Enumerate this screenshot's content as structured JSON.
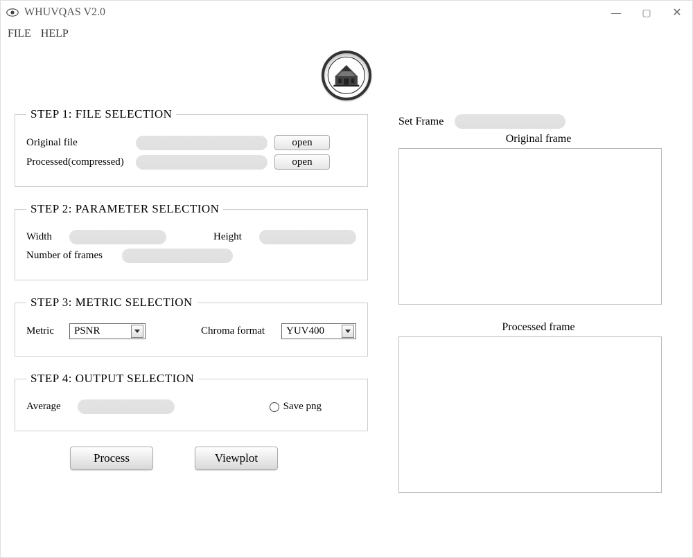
{
  "window": {
    "title": "WHUVQAS V2.0",
    "menu": {
      "file": "FILE",
      "help": "HELP"
    },
    "controls": {
      "min": "—",
      "max": "▢",
      "close": "✕"
    }
  },
  "logo": {
    "name": "university-seal"
  },
  "step1": {
    "legend": "STEP 1: FILE SELECTION",
    "original_label": "Original file",
    "processed_label": "Processed(compressed)",
    "open_label": "open"
  },
  "step2": {
    "legend": "STEP 2: PARAMETER SELECTION",
    "width_label": "Width",
    "height_label": "Height",
    "nframes_label": "Number of frames"
  },
  "step3": {
    "legend": "STEP 3: METRIC SELECTION",
    "metric_label": "Metric",
    "metric_value": "PSNR",
    "chroma_label": "Chroma format",
    "chroma_value": "YUV400"
  },
  "step4": {
    "legend": "STEP 4: OUTPUT SELECTION",
    "average_label": "Average",
    "savepng_label": "Save png"
  },
  "actions": {
    "process": "Process",
    "viewplot": "Viewplot"
  },
  "right": {
    "setframe_label": "Set Frame",
    "original_frame_label": "Original frame",
    "processed_frame_label": "Processed frame"
  }
}
